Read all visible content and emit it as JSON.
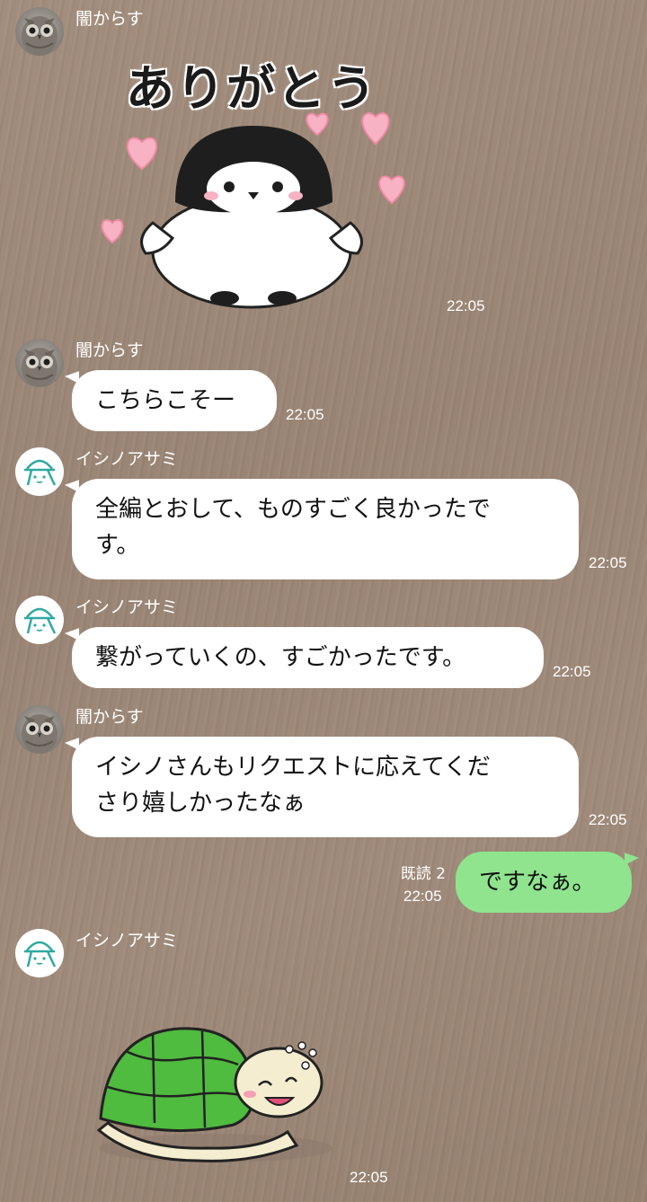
{
  "messages": [
    {
      "sender": "闇からす",
      "sticker_text": "ありがとう",
      "sticker_icon": "penguin-hearts-sticker",
      "time": "22:05"
    },
    {
      "sender": "闇からす",
      "text": "こちらこそー",
      "time": "22:05"
    },
    {
      "sender": "イシノアサミ",
      "text_lines": [
        "全編とおして、ものすごく良かったで",
        "す。"
      ],
      "time": "22:05"
    },
    {
      "sender": "イシノアサミ",
      "text": "繋がっていくの、すごかったです。",
      "time": "22:05"
    },
    {
      "sender": "闇からす",
      "text_lines": [
        "イシノさんもリクエストに応えてくだ",
        "さり嬉しかったなぁ"
      ],
      "time": "22:05"
    },
    {
      "sender": "me",
      "read": "既読 2",
      "text": "ですなぁ。",
      "time": "22:05"
    },
    {
      "sender": "イシノアサミ",
      "sticker_icon": "turtle-sticker",
      "time": "22:05"
    }
  ],
  "colors": {
    "outgoing_bubble": "#8fe48d",
    "incoming_bubble": "#ffffff",
    "background": "#a08b7b"
  }
}
